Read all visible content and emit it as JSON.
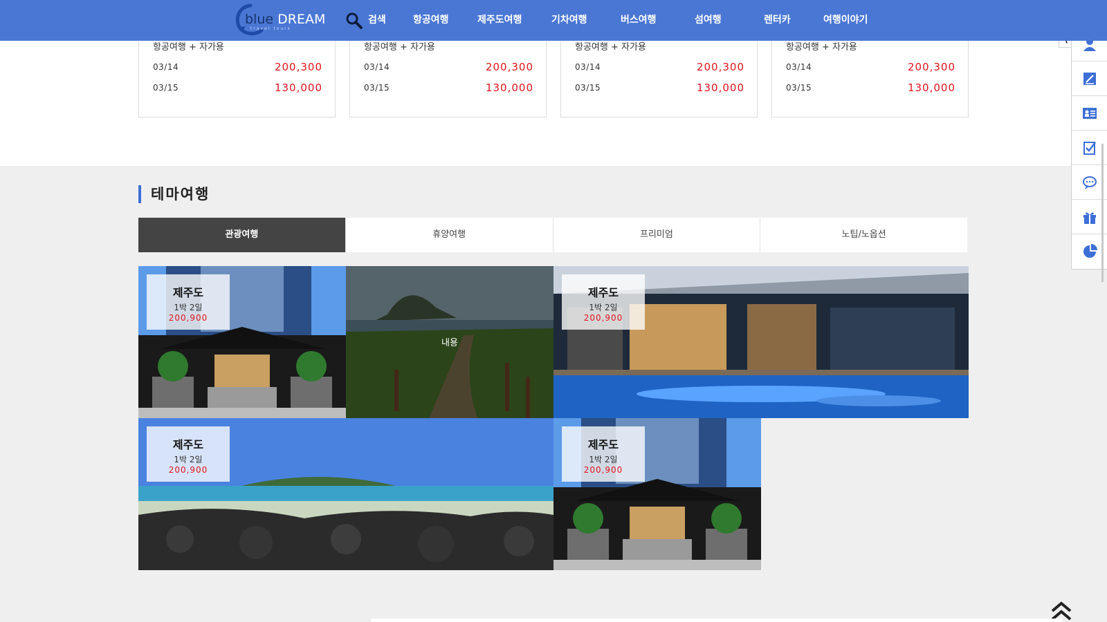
{
  "header": {
    "logo": {
      "word1": "blue",
      "word2": "DREAM",
      "tagline": "travel tours"
    },
    "search_label": "검색",
    "nav": [
      "항공여행",
      "제주도여행",
      "기차여행",
      "버스여행",
      "섬여행",
      "렌터카",
      "여행이야기"
    ],
    "colors": {
      "bar": "#4a77d4"
    }
  },
  "cards": [
    {
      "subtitle": "항공여행 + 자가용",
      "rows": [
        {
          "date": "03/14",
          "price": "200,300"
        },
        {
          "date": "03/15",
          "price": "130,000"
        }
      ]
    },
    {
      "subtitle": "항공여행 + 자가용",
      "rows": [
        {
          "date": "03/14",
          "price": "200,300"
        },
        {
          "date": "03/15",
          "price": "130,000"
        }
      ]
    },
    {
      "subtitle": "항공여행 + 자가용",
      "rows": [
        {
          "date": "03/14",
          "price": "200,300"
        },
        {
          "date": "03/15",
          "price": "130,000"
        }
      ]
    },
    {
      "subtitle": "항공여행 + 자가용",
      "rows": [
        {
          "date": "03/14",
          "price": "200,300"
        },
        {
          "date": "03/15",
          "price": "130,000"
        }
      ]
    }
  ],
  "theme": {
    "title": "테마여행",
    "tabs": [
      {
        "label": "관광여행",
        "active": true
      },
      {
        "label": "휴양여행",
        "active": false
      },
      {
        "label": "프리미엄",
        "active": false
      },
      {
        "label": "노팁/노옵션",
        "active": false
      }
    ],
    "tiles": [
      {
        "image": "hotel-entrance-photo",
        "title": "제주도",
        "duration": "1박 2일",
        "price": "200,900"
      },
      {
        "image": "coastal-trail-photo",
        "overlay": "내용"
      },
      {
        "image": "pool-villa-photo",
        "title": "제주도",
        "duration": "1박 2일",
        "price": "200,900"
      },
      {
        "image": "basalt-beach-photo",
        "title": "제주도",
        "duration": "1박 2일",
        "price": "200,900"
      },
      {
        "image": "hotel-entrance-photo",
        "title": "제주도",
        "duration": "1박 2일",
        "price": "200,900"
      }
    ]
  },
  "quickbar": {
    "collapse_icon": "chevron-left-icon",
    "icons": [
      "user-icon",
      "edit-note-icon",
      "contact-card-icon",
      "checklist-icon",
      "chat-icon",
      "gift-icon",
      "pie-chart-icon"
    ],
    "accent": "#3d6fd6"
  },
  "colors": {
    "price": "#e0141e",
    "active_tab": "#444444",
    "section_bg": "#efefef"
  }
}
